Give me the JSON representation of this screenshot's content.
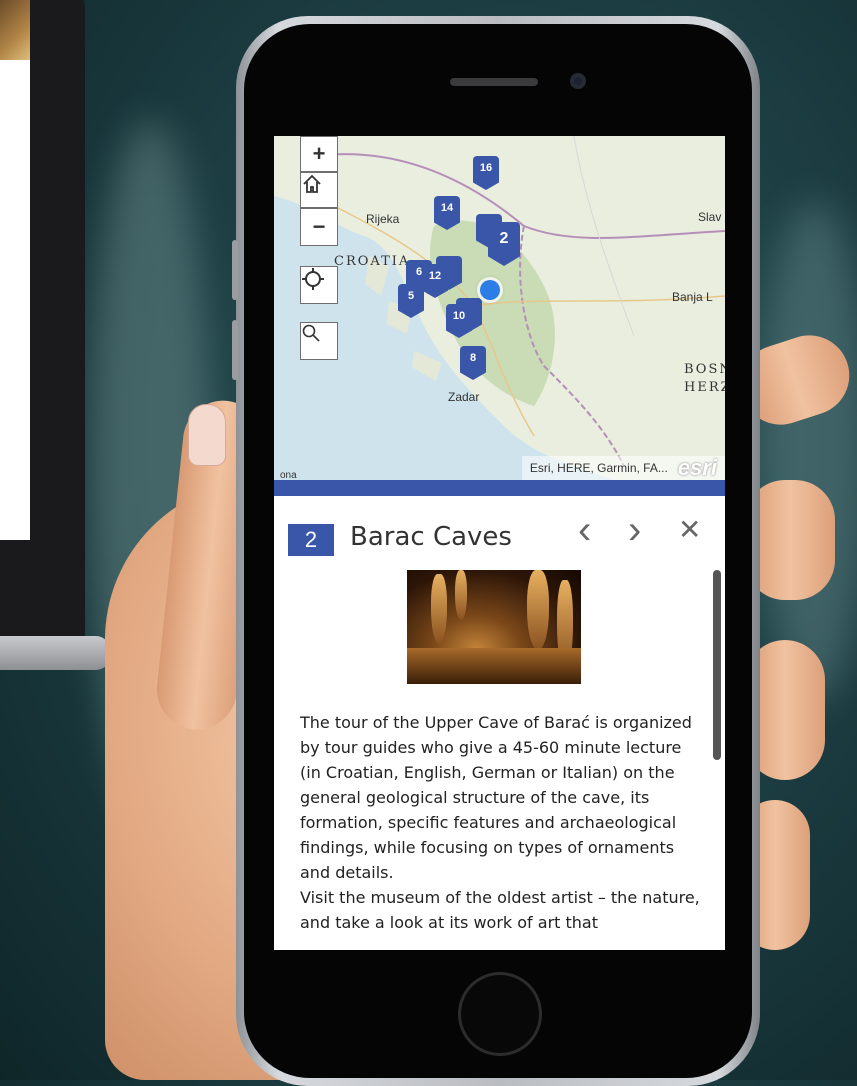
{
  "map": {
    "controls": {
      "zoom_in": "+",
      "zoom_out": "−"
    },
    "labels": {
      "rijeka": "Rijeka",
      "croatia": "CROATIA",
      "slav": "Slav",
      "banja": "Banja L",
      "bosnia1": "BOSN",
      "bosnia2": "HERZI",
      "zadar": "Zadar",
      "ona": "ona"
    },
    "pins": [
      "16",
      "14",
      "2",
      "6",
      "12",
      "5",
      "10",
      "8"
    ],
    "attribution": "Esri, HERE, Garmin, FA...",
    "esri_logo": "esri"
  },
  "panel": {
    "number": "2",
    "title": "Barac Caves",
    "prev_icon": "‹",
    "next_icon": "›",
    "close_icon": "✕",
    "description": "The tour of the Upper Cave of Barać is organized by tour guides who give a 45-60 minute lecture (in Croatian, English, German or Italian) on the general geological structure of the cave, its formation, specific features and archaeological findings, while focusing on types of ornaments and details.\nVisit the museum of the oldest artist – the nature, and take a look at its work of art that"
  },
  "colors": {
    "accent": "#3a56a8"
  }
}
